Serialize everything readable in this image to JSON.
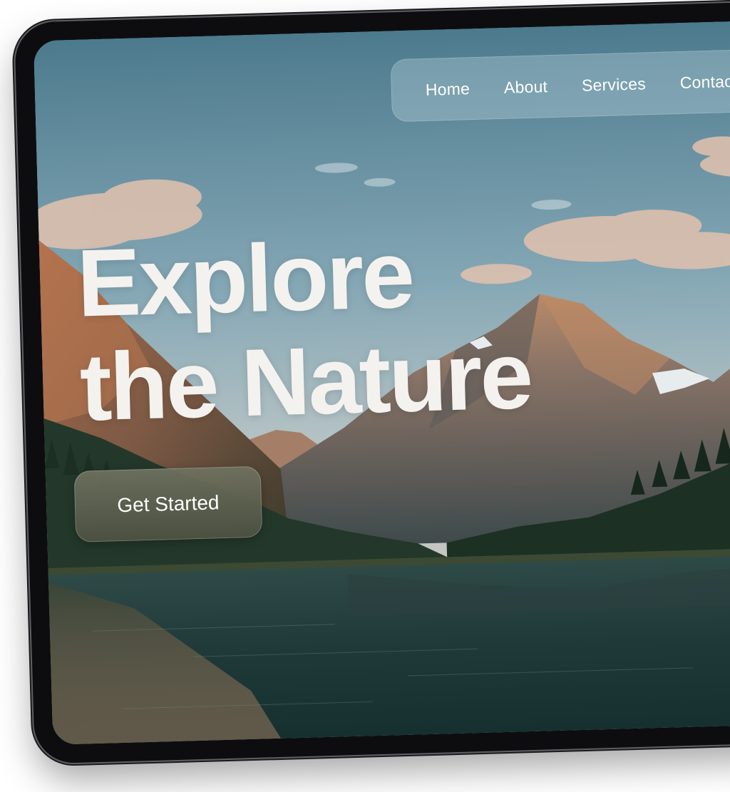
{
  "nav": {
    "items": [
      {
        "label": "Home"
      },
      {
        "label": "About"
      },
      {
        "label": "Services"
      },
      {
        "label": "Contact"
      }
    ]
  },
  "hero": {
    "title_line1": "Explore",
    "title_line2": "the Nature",
    "cta_label": "Get Started"
  },
  "colors": {
    "sky_top": "#4f7c8e",
    "sky_bottom": "#b8c7cc",
    "lake": "#1f3a3a",
    "forest": "#1f3327",
    "cta_bg": "#5f6352"
  }
}
